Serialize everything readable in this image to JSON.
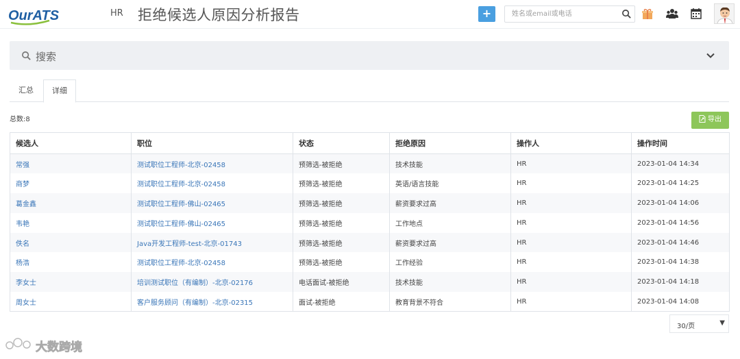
{
  "header": {
    "logo_text": "OurATS",
    "role": "HR",
    "title": "拒绝候选人原因分析报告",
    "add_label": "+",
    "search_placeholder": "姓名或email或电话",
    "icons": [
      "plus-icon",
      "search-icon",
      "gift-icon",
      "users-icon",
      "calendar-icon",
      "avatar"
    ]
  },
  "search_panel": {
    "label": "搜索"
  },
  "tabs": [
    {
      "label": "汇总",
      "active": false
    },
    {
      "label": "详细",
      "active": true
    }
  ],
  "summary": {
    "total": "总数:8"
  },
  "toolbar": {
    "export_label": "导出"
  },
  "table": {
    "columns": [
      "候选人",
      "职位",
      "状态",
      "拒绝原因",
      "操作人",
      "操作时间"
    ],
    "rows": [
      [
        "常强",
        "测试职位工程师-北京-02458",
        "预筛选-被拒绝",
        "技术技能",
        "HR",
        "2023-01-04 14:34"
      ],
      [
        "商梦",
        "测试职位工程师-北京-02458",
        "预筛选-被拒绝",
        "英语/语言技能",
        "HR",
        "2023-01-04 14:25"
      ],
      [
        "葛金鑫",
        "测试职位工程师-佛山-02465",
        "预筛选-被拒绝",
        "薪资要求过高",
        "HR",
        "2023-01-04 14:06"
      ],
      [
        "韦艳",
        "测试职位工程师-佛山-02465",
        "预筛选-被拒绝",
        "工作地点",
        "HR",
        "2023-01-04 14:56"
      ],
      [
        "佚名",
        "Java开发工程师-test-北京-01743",
        "预筛选-被拒绝",
        "薪资要求过高",
        "HR",
        "2023-01-04 14:46"
      ],
      [
        "杨浩",
        "测试职位工程师-北京-02458",
        "预筛选-被拒绝",
        "工作经验",
        "HR",
        "2023-01-04 14:38"
      ],
      [
        "李女士",
        "培训测试职位（有编制）-北京-02176",
        "电话面试-被拒绝",
        "技术技能",
        "HR",
        "2023-01-04 14:18"
      ],
      [
        "周女士",
        "客户服务顾问（有编制）-北京-02315",
        "面试-被拒绝",
        "教育背景不符合",
        "HR",
        "2023-01-04 14:08"
      ]
    ]
  },
  "pager": {
    "page_size": "30/页",
    "arrow": "▼"
  },
  "watermark": {
    "text": "大数跨境"
  },
  "colors": {
    "accent_blue": "#4a9fe0",
    "link_blue": "#3a76b8",
    "export_green": "#8dc65a",
    "panel_gray": "#eef0f3"
  }
}
